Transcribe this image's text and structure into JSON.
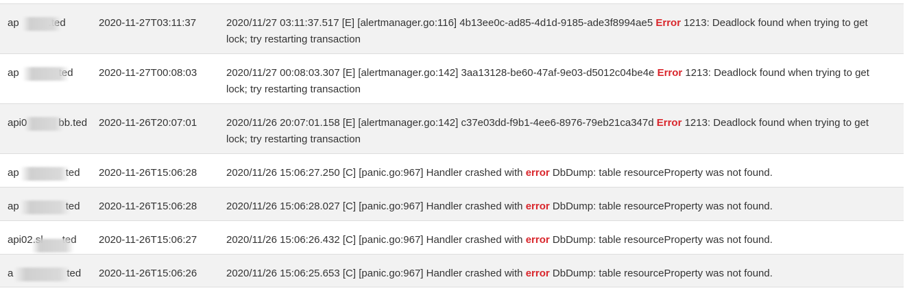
{
  "rows": [
    {
      "host": "api...ted",
      "time": "2020-11-27T03:11:37",
      "msg_pre": "2020/11/27 03:11:37.517 [E] [alertmanager.go:116] 4b13ee0c-ad85-4d1d-9185-ade3f8994ae5 ",
      "msg_kw": "Error",
      "msg_post": " 1213: Deadlock found when trying to get lock; try restarting transaction"
    },
    {
      "host": "api...ted",
      "time": "2020-11-27T00:08:03",
      "msg_pre": "2020/11/27 00:08:03.307 [E] [alertmanager.go:142] 3aa13128-be60-47af-9e03-d5012c04be4e ",
      "msg_kw": "Error",
      "msg_post": " 1213: Deadlock found when trying to get lock; try restarting transaction"
    },
    {
      "host": "api0...bb.ted",
      "time": "2020-11-26T20:07:01",
      "msg_pre": "2020/11/26 20:07:01.158 [E] [alertmanager.go:142] c37e03dd-f9b1-4ee6-8976-79eb21ca347d ",
      "msg_kw": "Error",
      "msg_post": " 1213: Deadlock found when trying to get lock; try restarting transaction"
    },
    {
      "host": "ap...ted",
      "time": "2020-11-26T15:06:28",
      "msg_pre": "2020/11/26 15:06:27.250 [C] [panic.go:967] Handler crashed with ",
      "msg_kw": "error",
      "msg_post": " DbDump: table resourceProperty was not found."
    },
    {
      "host": "ap...ted",
      "time": "2020-11-26T15:06:28",
      "msg_pre": "2020/11/26 15:06:28.027 [C] [panic.go:967] Handler crashed with ",
      "msg_kw": "error",
      "msg_post": " DbDump: table resourceProperty was not found."
    },
    {
      "host": "api02.sl...ted",
      "time": "2020-11-26T15:06:27",
      "msg_pre": "2020/11/26 15:06:26.432 [C] [panic.go:967] Handler crashed with ",
      "msg_kw": "error",
      "msg_post": " DbDump: table resourceProperty was not found."
    },
    {
      "host": "a...ted",
      "time": "2020-11-26T15:06:26",
      "msg_pre": "2020/11/26 15:06:25.653 [C] [panic.go:967] Handler crashed with ",
      "msg_kw": "error",
      "msg_post": " DbDump: table resourceProperty was not found."
    }
  ],
  "host_display": [
    "ap",
    "ap",
    "api0",
    "ap",
    "ap",
    "api02.sl",
    "a"
  ],
  "host_suffix": [
    ".ted",
    "ted",
    "bb.ted",
    "ted",
    "ted",
    "ted",
    "ted"
  ],
  "colors": {
    "error_keyword": "#d9262c",
    "row_alt": "#f2f2f2",
    "border": "#dddddd"
  }
}
